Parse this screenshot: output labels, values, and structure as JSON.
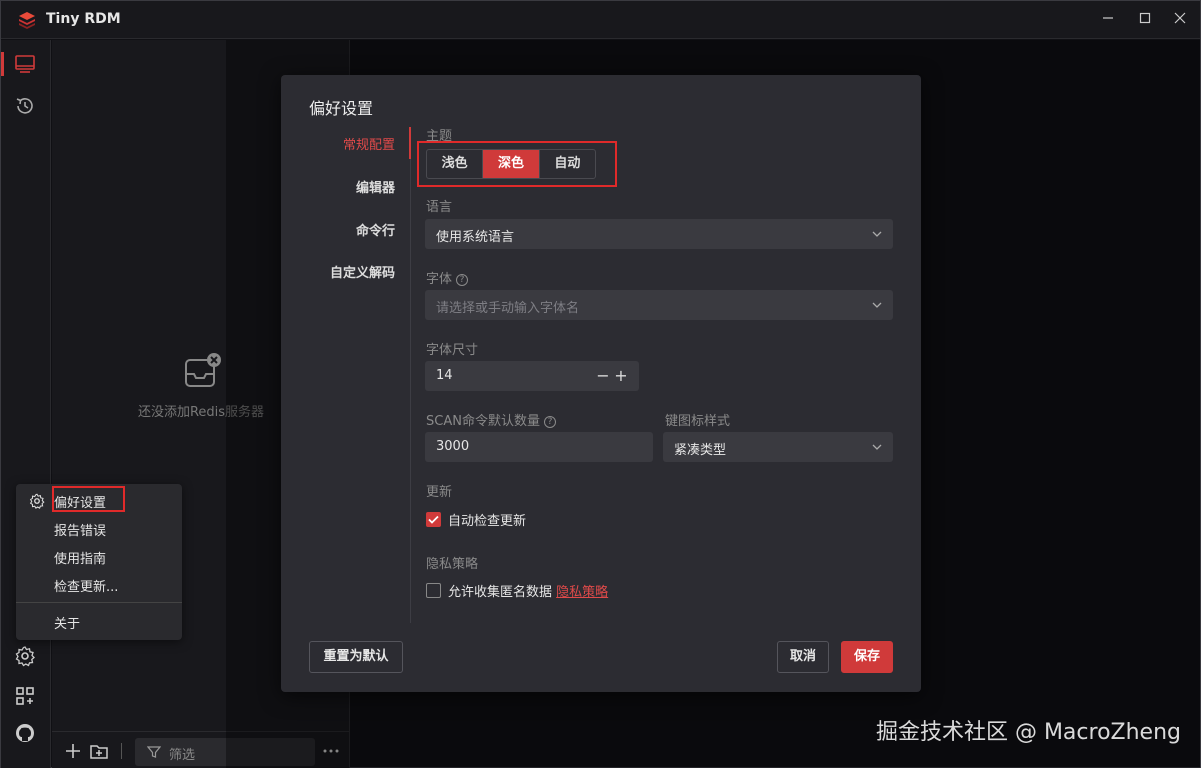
{
  "window": {
    "title": "Tiny RDM"
  },
  "sidebar": {
    "empty_text": "还没添加Redis服务器",
    "filter_placeholder": "筛选"
  },
  "menu": {
    "items": [
      "偏好设置",
      "报告错误",
      "使用指南",
      "检查更新...",
      "关于"
    ]
  },
  "dialog": {
    "title": "偏好设置",
    "tabs": [
      "常规配置",
      "编辑器",
      "命令行",
      "自定义解码"
    ],
    "active_tab": "常规配置",
    "theme": {
      "label": "主题",
      "options": [
        "浅色",
        "深色",
        "自动"
      ],
      "selected": "深色"
    },
    "language": {
      "label": "语言",
      "value": "使用系统语言"
    },
    "font": {
      "label": "字体",
      "placeholder": "请选择或手动输入字体名"
    },
    "font_size": {
      "label": "字体尺寸",
      "value": "14"
    },
    "scan_count": {
      "label": "SCAN命令默认数量",
      "value": "3000"
    },
    "key_icon_style": {
      "label": "键图标样式",
      "value": "紧凑类型"
    },
    "update": {
      "label": "更新",
      "checkbox": "自动检查更新",
      "checked": true
    },
    "privacy": {
      "label": "隐私策略",
      "checkbox": "允许收集匿名数据",
      "link": "隐私策略",
      "checked": false
    },
    "buttons": {
      "reset": "重置为默认",
      "cancel": "取消",
      "save": "保存"
    }
  },
  "watermark": "掘金技术社区 @ MacroZheng",
  "colors": {
    "accent": "#d03a3a",
    "background": "#101014",
    "panel": "#2c2c32"
  }
}
